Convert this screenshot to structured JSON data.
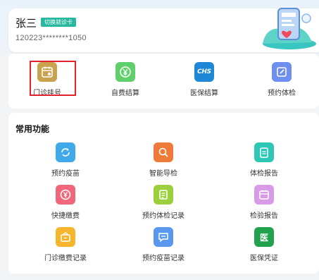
{
  "user": {
    "name": "张三",
    "card_tag": "切换就诊卡",
    "card_number": "120223********1050"
  },
  "quick_actions": [
    {
      "label": "门诊挂号",
      "icon": "calendar-icon",
      "color": "#c9a24d"
    },
    {
      "label": "自费结算",
      "icon": "yen-coin-icon",
      "color": "#5fcf6b"
    },
    {
      "label": "医保结算",
      "icon": "chs-logo-icon",
      "icon_text": "CHS",
      "color": "#1e88d6"
    },
    {
      "label": "预约体检",
      "icon": "edit-icon",
      "color": "#6e8ff0"
    }
  ],
  "common": {
    "title": "常用功能",
    "items": [
      {
        "label": "预约疫苗",
        "icon": "vaccine-icon",
        "color": "#3fa9ea"
      },
      {
        "label": "智能导检",
        "icon": "guide-icon",
        "color": "#f07a3a"
      },
      {
        "label": "体检报告",
        "icon": "clipboard-icon",
        "color": "#2ec7b6"
      },
      {
        "label": "快捷缴费",
        "icon": "yen-icon",
        "color": "#f0667a"
      },
      {
        "label": "预约体检记录",
        "icon": "checklist-icon",
        "color": "#9ccf3c"
      },
      {
        "label": "检验报告",
        "icon": "calendar-report-icon",
        "color": "#d79ae6"
      },
      {
        "label": "门诊缴费记录",
        "icon": "wallet-icon",
        "color": "#f7b52c"
      },
      {
        "label": "预约疫苗记录",
        "icon": "chat-record-icon",
        "color": "#5a98ee"
      },
      {
        "label": "医保凭证",
        "icon": "medical-insurance-icon",
        "icon_text": "医",
        "color": "#23a24d"
      }
    ]
  }
}
